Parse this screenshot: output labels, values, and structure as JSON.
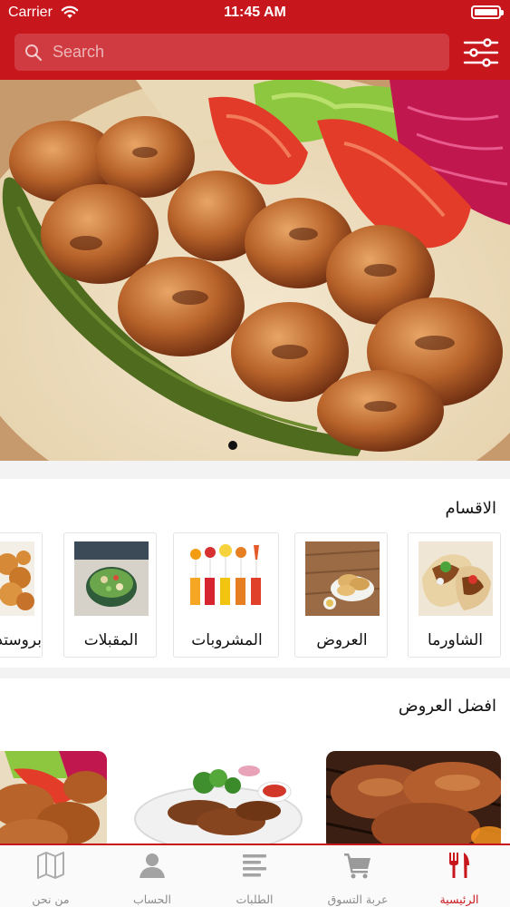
{
  "status_bar": {
    "carrier": "Carrier",
    "time": "11:45 AM"
  },
  "search": {
    "placeholder": "Search"
  },
  "banner": {
    "pages": 1,
    "current_page": 1
  },
  "categories": {
    "title": "الاقسام",
    "items": [
      {
        "label": "الشاورما",
        "icon": "shawarma-image"
      },
      {
        "label": "العروض",
        "icon": "offers-image"
      },
      {
        "label": "المشروبات",
        "icon": "drinks-image"
      },
      {
        "label": "المقبلات",
        "icon": "appetizers-image"
      },
      {
        "label": "بروستد",
        "icon": "broasted-image"
      }
    ]
  },
  "best_offers": {
    "title": "افضل العروض"
  },
  "tabbar": {
    "items": [
      {
        "label": "الرئيسية",
        "icon": "utensils-icon",
        "active": true
      },
      {
        "label": "عربة التسوق",
        "icon": "cart-icon",
        "active": false
      },
      {
        "label": "الطلبات",
        "icon": "list-icon",
        "active": false
      },
      {
        "label": "الحساب",
        "icon": "user-icon",
        "active": false
      },
      {
        "label": "من نحن",
        "icon": "map-icon",
        "active": false
      }
    ]
  },
  "colors": {
    "brand": "#c8161d",
    "tab_inactive": "#8c8c8c",
    "background": "#f3f3f3"
  }
}
